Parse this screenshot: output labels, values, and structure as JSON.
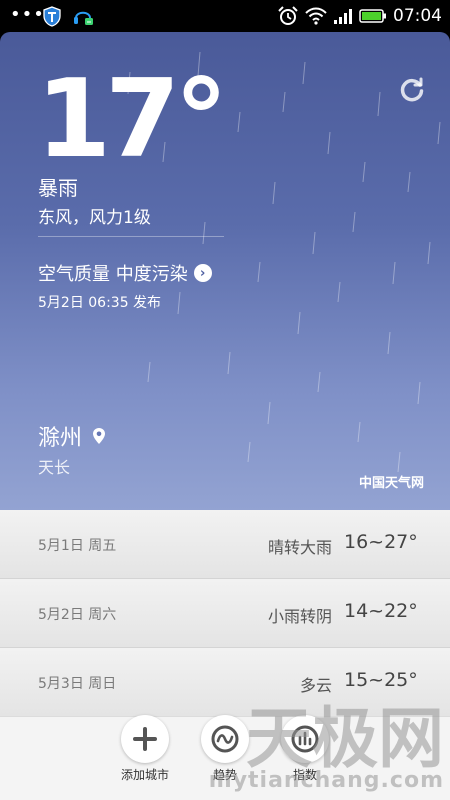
{
  "status_bar": {
    "time": "07:04"
  },
  "weather": {
    "temperature": "17°",
    "condition": "暴雨",
    "wind": "东风，风力1级",
    "air_quality": "空气质量 中度污染",
    "publish_time": "5月2日 06:35 发布",
    "city": "滁州",
    "district": "天长",
    "source": "中国天气网"
  },
  "forecast": [
    {
      "date": "5月1日 周五",
      "desc": "晴转大雨",
      "temp": "16~27°"
    },
    {
      "date": "5月2日 周六",
      "desc": "小雨转阴",
      "temp": "14~22°"
    },
    {
      "date": "5月3日 周日",
      "desc": "多云",
      "temp": "15~25°"
    }
  ],
  "bottom_bar": {
    "add_city": "添加城市",
    "trend": "趋势",
    "index": "指数"
  },
  "watermark": {
    "logo_text": "天极网",
    "url": "mytianchang.com"
  },
  "colors": {
    "sky_top": "#4a5a99",
    "sky_bottom": "#93a3d2",
    "battery": "#4cd12b"
  }
}
